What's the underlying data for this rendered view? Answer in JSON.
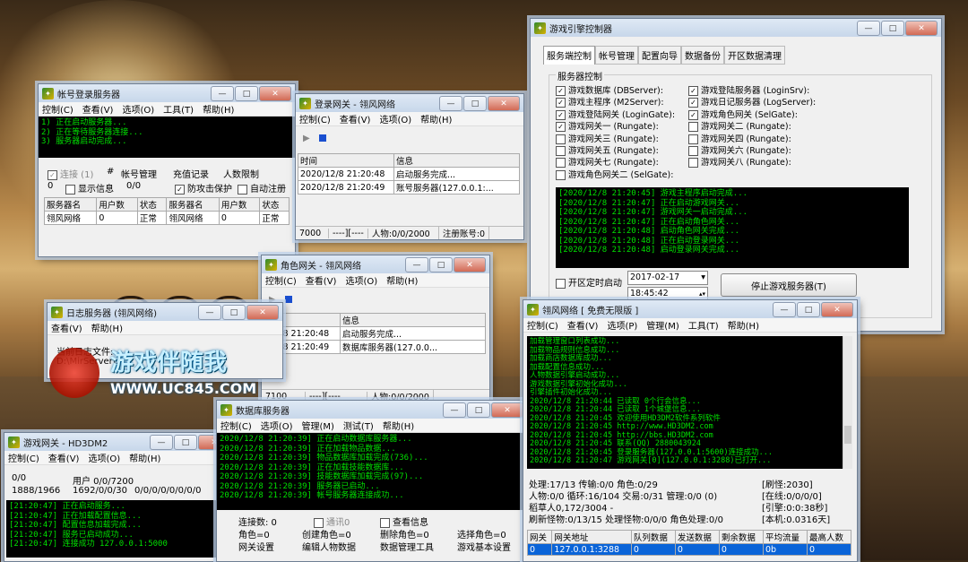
{
  "account_server": {
    "title": "帐号登录服务器",
    "menu": [
      "控制(C)",
      "查看(V)",
      "选项(O)",
      "工具(T)",
      "帮助(H)"
    ],
    "console": [
      "1) 正在启动服务器...",
      "2) 正在等待服务器连接...",
      "3) 服务器启动完成..."
    ],
    "row1": [
      "连接 (1)",
      "#",
      "帐号管理",
      "充值记录",
      "人数限制"
    ],
    "row2": [
      "0",
      "显示信息",
      "0/0",
      "防攻击保护",
      "自动注册"
    ],
    "table_headers": [
      "服务器名",
      "用户数",
      "状态",
      "服务器名",
      "用户数",
      "状态"
    ],
    "table_row": [
      "翎风网络",
      "0",
      "正常",
      "翎风网络",
      "0",
      "正常"
    ]
  },
  "login_gate": {
    "title": "登录网关 - 翎风网络",
    "menu": [
      "控制(C)",
      "查看(V)",
      "选项(O)",
      "帮助(H)"
    ],
    "headers": [
      "时间",
      "信息"
    ],
    "rows": [
      [
        "2020/12/8 21:20:48",
        "启动服务完成..."
      ],
      [
        "2020/12/8 21:20:49",
        "账号服务器(127.0.0.1:..."
      ]
    ],
    "status": [
      "7000",
      "----][----",
      "人物:0/0/2000",
      "注册账号:0"
    ]
  },
  "role_gate": {
    "title": "角色网关 - 翎风网络",
    "menu": [
      "控制(C)",
      "查看(V)",
      "选项(O)",
      "帮助(H)"
    ],
    "headers": [
      "信息"
    ],
    "rows": [
      [
        "/12/8 21:20:48",
        "启动服务完成..."
      ],
      [
        "/12/8 21:20:49",
        "数据库服务器(127.0.0..."
      ]
    ],
    "status": [
      "7100",
      "----][----",
      "人物:0/0/2000"
    ]
  },
  "log_server": {
    "title": "日志服务器 (翎风网络)",
    "menu": [
      "查看(V)",
      "帮助(H)"
    ],
    "line1": "当前日志文件:",
    "line2": "D:\\MirServer\\..."
  },
  "watermark": {
    "site": "WWW.UC845.COM",
    "brand": "游戏伴随我"
  },
  "game_gate": {
    "title": "游戏网关 - HD3DM2",
    "menu": [
      "控制(C)",
      "查看(V)",
      "选项(O)",
      "帮助(H)"
    ],
    "info1": [
      "0/0",
      "用户 0/0/7200"
    ],
    "info2": [
      "1888/1966",
      "1692/0/0/30",
      "0/0/0/0/0/0/0/0"
    ],
    "console": [
      "[21:20:47] 正在启动服务...",
      "[21:20:47] 正在加载配置信息...",
      "[21:20:47] 配置信息加载完成...",
      "[21:20:47] 服务已启动成功...",
      "[21:20:47] 连接成功 127.0.0.1:5000"
    ]
  },
  "db_server": {
    "title": "数据库服务器",
    "menu": [
      "控制(C)",
      "选项(O)",
      "管理(M)",
      "测试(T)",
      "帮助(H)"
    ],
    "console": [
      "2020/12/8 21:20:39] 正在启动数据库服务器...",
      "2020/12/8 21:20:39] 正在加载物品数据...",
      "2020/12/8 21:20:39] 物品数据库加载完成(736)...",
      "2020/12/8 21:20:39] 正在加载技能数据库...",
      "2020/12/8 21:20:39] 技能数据库加载完成(97)...",
      "2020/12/8 21:20:39] 服务器已启动...",
      "2020/12/8 21:20:39] 帐号服务器连接成功..."
    ],
    "row1": [
      "连接数: 0",
      "通讯0",
      "查看信息"
    ],
    "row2": [
      "角色=0",
      "创建角色=0",
      "删除角色=0",
      "选择角色=0"
    ],
    "row3": [
      "网关设置",
      "编辑人物数据",
      "数据管理工具",
      "游戏基本设置"
    ]
  },
  "engine_controller": {
    "title": "游戏引擎控制器",
    "tabs": [
      "服务端控制",
      "帐号管理",
      "配置向导",
      "数据备份",
      "开区数据清理"
    ],
    "group_label": "服务器控制",
    "left_checks": [
      {
        "label": "游戏数据库 (DBServer):",
        "checked": true
      },
      {
        "label": "游戏主程序 (M2Server):",
        "checked": true
      },
      {
        "label": "游戏登陆网关 (LoginGate):",
        "checked": true
      },
      {
        "label": "游戏网关一 (Rungate):",
        "checked": true
      },
      {
        "label": "游戏网关三 (Rungate):",
        "checked": false
      },
      {
        "label": "游戏网关五 (Rungate):",
        "checked": false
      },
      {
        "label": "游戏网关七 (Rungate):",
        "checked": false
      },
      {
        "label": "游戏角色网关二 (SelGate):",
        "checked": false
      }
    ],
    "right_checks": [
      {
        "label": "游戏登陆服务器 (LoginSrv):",
        "checked": true
      },
      {
        "label": "游戏日记服务器 (LogServer):",
        "checked": true
      },
      {
        "label": "游戏角色网关 (SelGate):",
        "checked": true
      },
      {
        "label": "游戏网关二 (Rungate):",
        "checked": false
      },
      {
        "label": "游戏网关四 (Rungate):",
        "checked": false
      },
      {
        "label": "游戏网关六 (Rungate):",
        "checked": false
      },
      {
        "label": "游戏网关八 (Rungate):",
        "checked": false
      }
    ],
    "console": [
      "[2020/12/8 21:20:45] 游戏主程序启动完成...",
      "[2020/12/8 21:20:47] 正在启动游戏网关...",
      "[2020/12/8 21:20:47] 游戏网关一启动完成...",
      "[2020/12/8 21:20:47] 正在启动角色网关...",
      "[2020/12/8 21:20:48] 启动角色网关完成...",
      "[2020/12/8 21:20:48] 正在启动登录网关...",
      "[2020/12/8 21:20:48] 启动登录网关完成..."
    ],
    "timer_label": "开区定时启动",
    "date": "2017-02-17",
    "time": "18:45:42",
    "stop_button": "停止游戏服务器(T)"
  },
  "main_server": {
    "title": "翎风网络 [ 免费无限版 ]",
    "menu": [
      "控制(C)",
      "查看(V)",
      "选项(P)",
      "管理(M)",
      "工具(T)",
      "帮助(H)"
    ],
    "console": [
      "加载管理窗口列表成功...",
      "加载物品规则信息成功...",
      "加载商店数据库成功...",
      "加载配置信息成功...",
      "人物数据引擎启动成功...",
      "游戏数据引擎初始化成功...",
      "引擎插件初始化成功...",
      "2020/12/8 21:20:44 已读取 0个行会信息...",
      "2020/12/8 21:20:44 已读取 1个城堡信息...",
      "2020/12/8 21:20:45 欢迎使用HD3DM2软件系列软件",
      "2020/12/8 21:20:45 http://www.HD3DM2.com",
      "2020/12/8 21:20:45 http://bbs.HD3DM2.com",
      "2020/12/8 21:20:45 联系(QQ) 2880043924",
      "2020/12/8 21:20:45 登录服务器(127.0.0.1:5600)连接成功...",
      "2020/12/8 21:20:47 游戏网关[0](127.0.0.1:3288)已打开..."
    ],
    "stats": [
      "处理:17/13 传输:0/0 角色:0/29",
      "人物:0/0 循环:16/104 交易:0/31 管理:0/0 (0)",
      "稻草人0,172/3004 -",
      "刷新怪物:0/13/15 处理怪物:0/0/0 角色处理:0/0"
    ],
    "stats_right": [
      "[刷怪:2030]",
      "[在线:0/0/0/0]",
      "[引擎:0:0:38秒]",
      "[本机:0.0316天]"
    ],
    "table_headers": [
      "网关",
      "网关地址",
      "队列数据",
      "发送数据",
      "剩余数据",
      "平均流量",
      "最高人数"
    ],
    "table_row": [
      "0",
      "127.0.0.1:3288",
      "0",
      "0",
      "0",
      "0b",
      "0"
    ]
  }
}
